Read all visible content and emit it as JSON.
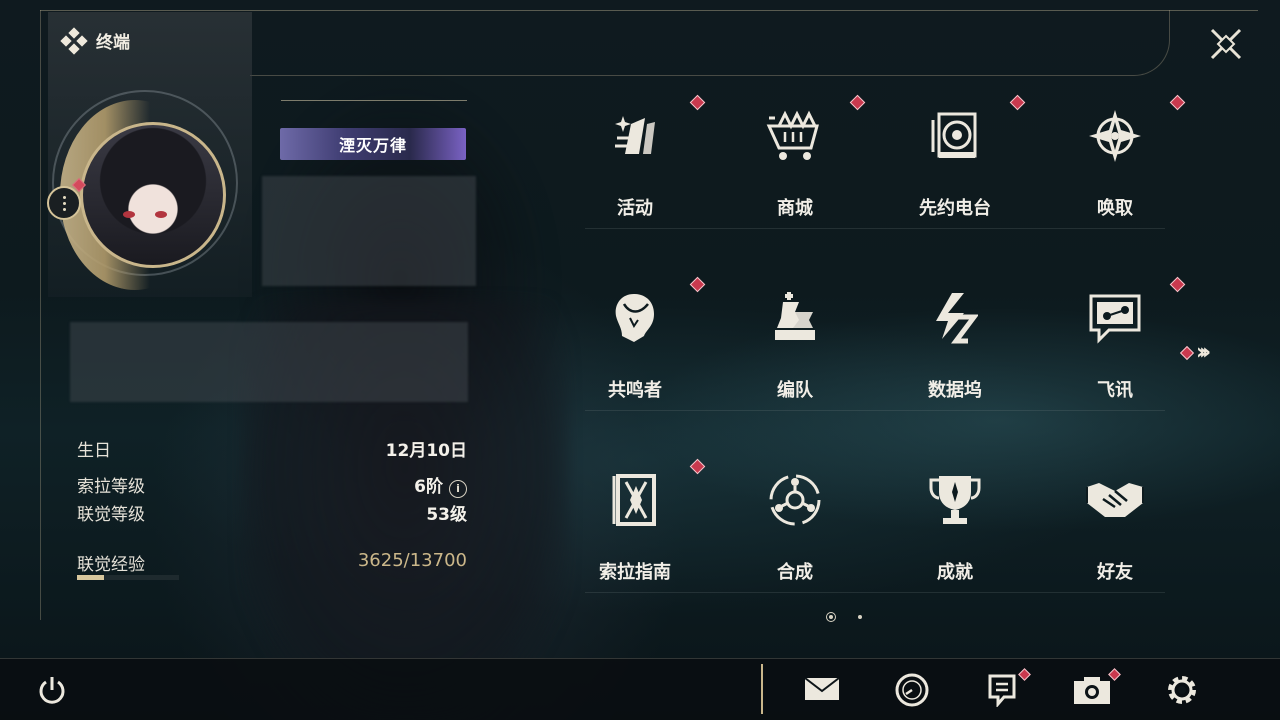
{
  "header": {
    "title": "终端"
  },
  "profile": {
    "title_badge": "湮灭万律",
    "birthday_label": "生日",
    "birthday_value": "12月10日",
    "sola_level_label": "索拉等级",
    "sola_level_value": "6阶",
    "union_level_label": "联觉等级",
    "union_level_value": "53级",
    "exp_label": "联觉经验",
    "exp_value": "3625/13700",
    "exp_progress": 0.2646
  },
  "menu": [
    {
      "label": "活动",
      "icon": "activity-icon",
      "badge": true
    },
    {
      "label": "商城",
      "icon": "shop-cart-icon",
      "badge": true
    },
    {
      "label": "先约电台",
      "icon": "radio-icon",
      "badge": true
    },
    {
      "label": "唤取",
      "icon": "summon-compass-icon",
      "badge": true
    },
    {
      "label": "共鸣者",
      "icon": "resonator-head-icon",
      "badge": true
    },
    {
      "label": "编队",
      "icon": "chess-team-icon",
      "badge": false
    },
    {
      "label": "数据坞",
      "icon": "data-bank-icon",
      "badge": false
    },
    {
      "label": "飞讯",
      "icon": "message-chat-icon",
      "badge": true
    },
    {
      "label": "索拉指南",
      "icon": "guide-book-icon",
      "badge": true
    },
    {
      "label": "合成",
      "icon": "synthesis-icon",
      "badge": false
    },
    {
      "label": "成就",
      "icon": "trophy-icon",
      "badge": false
    },
    {
      "label": "好友",
      "icon": "handshake-icon",
      "badge": false
    }
  ],
  "pager": {
    "current": 1,
    "total": 2
  },
  "colors": {
    "accent_gold": "#c9b68b",
    "badge_red": "#c9394e",
    "exp_gold": "#cbb78a"
  },
  "bottom_bar": {
    "icons": [
      "power-icon",
      "mail-icon",
      "clock-icon",
      "notice-icon",
      "camera-icon",
      "settings-gear-icon"
    ]
  }
}
